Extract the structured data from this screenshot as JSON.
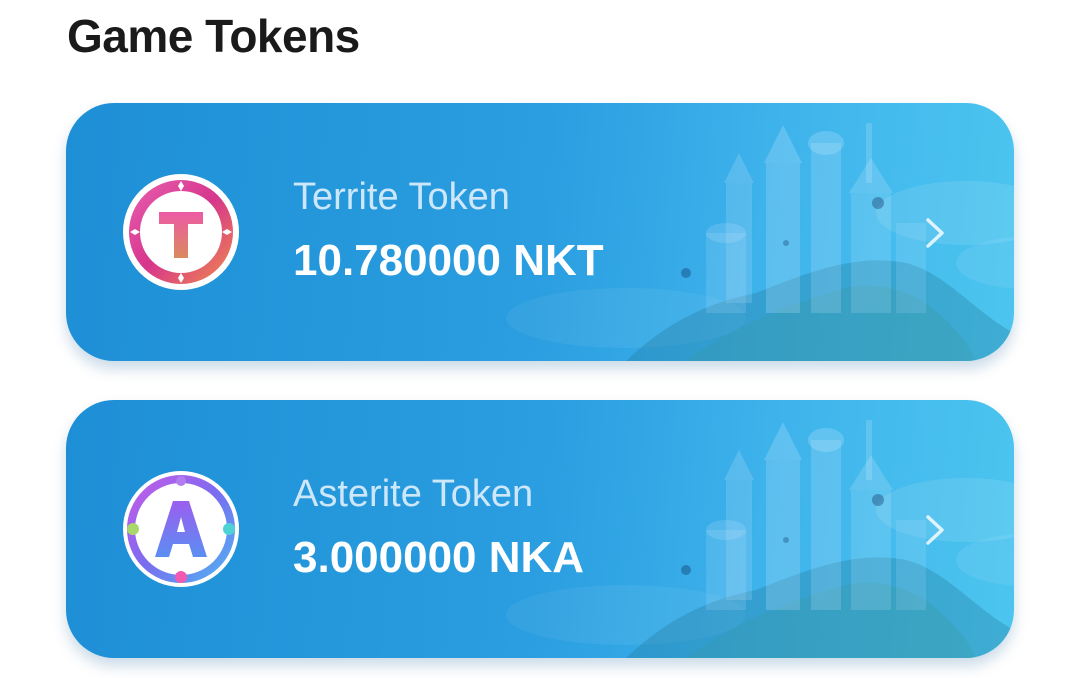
{
  "section": {
    "title": "Game Tokens"
  },
  "tokens": [
    {
      "name": "Territe Token",
      "amount": "10.780000 NKT",
      "logo_letter": "T",
      "icon": "territe-token-logo"
    },
    {
      "name": "Asterite Token",
      "amount": "3.000000 NKA",
      "logo_letter": "A",
      "icon": "asterite-token-logo"
    }
  ],
  "colors": {
    "card_gradient_start": "#1e8fd6",
    "card_gradient_end": "#4cc5ef",
    "title_text": "#1a1a1a",
    "token_name_text": "#ebf5ff",
    "amount_text": "#ffffff"
  },
  "icons": {
    "chevron": "chevron-right-icon",
    "background": "castle-island-illustration"
  }
}
